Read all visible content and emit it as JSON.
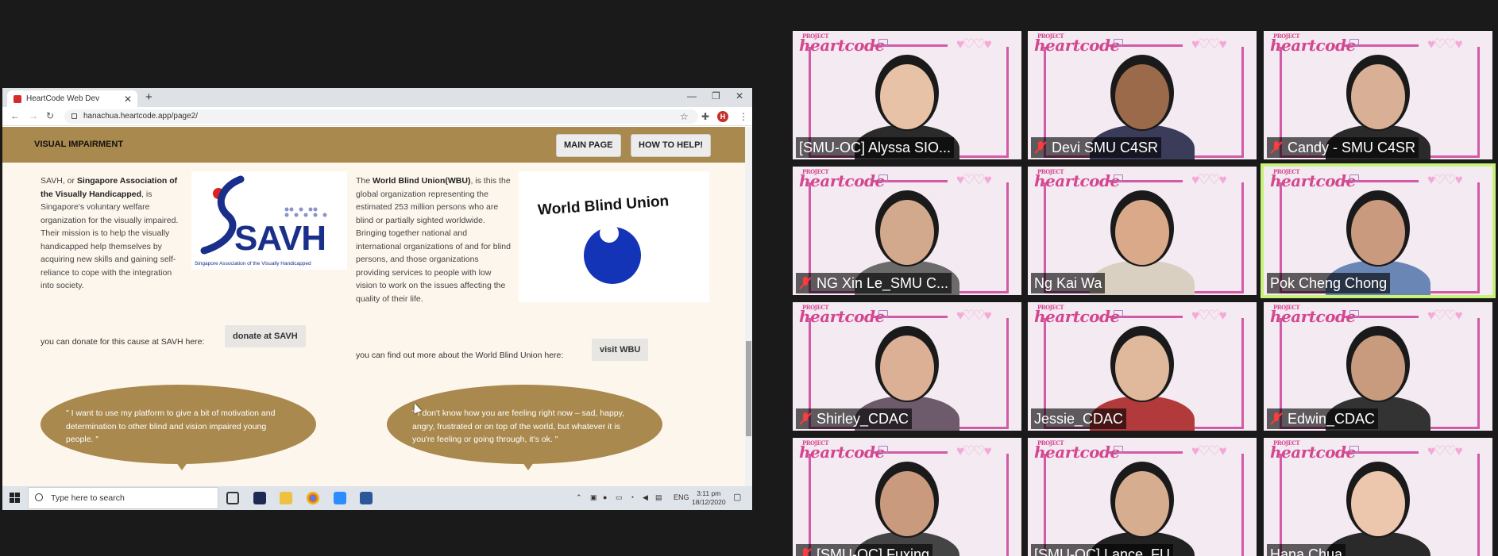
{
  "browser": {
    "tab_title": "HeartCode Web Dev",
    "new_tab": "+",
    "url": "hanachua.heartcode.app/page2/",
    "profile_initial": "H"
  },
  "site": {
    "nav_title": "VISUAL IMPAIRMENT",
    "main_page_button": "MAIN PAGE",
    "how_to_help_button": "HOW TO HELP!"
  },
  "savh": {
    "intro_prefix": "SAVH, or ",
    "name_bold": "Singapore Association of the Visually Handicapped",
    "description": ", is Singapore's voluntary welfare organization for the visually impaired. Their mission is to help the visually handicapped help themselves by acquiring new skills and gaining self-reliance to cope with the integration into society.",
    "logo_text": "SAVH",
    "logo_subtext": "Singapore Association of the Visually Handicapped",
    "cta_text": "you can donate for this cause at SAVH here:",
    "cta_button": "donate at SAVH"
  },
  "wbu": {
    "intro_prefix": "The ",
    "name_bold": "World Blind Union(WBU)",
    "description": ", is this the global organization representing the estimated 253 million persons who are blind or partially sighted worldwide. Bringing together national and international organizations of and for blind persons, and those organizations providing services to people with low vision to work on the issues affecting the quality of their life.",
    "logo_text": "World Blind Union",
    "cta_text": "you can find out more about the World Blind Union here:",
    "cta_button": "visit WBU"
  },
  "quotes": [
    "\" I want to use my platform to give a bit of motivation and determination to other blind and vision impaired young people. \"",
    "\" I don't know how you are feeling right now – sad, happy, angry, frustrated or on top of the world, but whatever it is you're feeling or going through, it's ok. \""
  ],
  "taskbar": {
    "search_placeholder": "Type here to search",
    "language": "ENG",
    "time": "3:11 pm",
    "date": "18/12/2020"
  },
  "participants": [
    {
      "name": "[SMU-OC] Alyssa SIO...",
      "muted": false
    },
    {
      "name": "Devi SMU C4SR",
      "muted": true
    },
    {
      "name": "Candy - SMU C4SR",
      "muted": true
    },
    {
      "name": "NG Xin Le_SMU C...",
      "muted": true
    },
    {
      "name": "Ng Kai Wa",
      "muted": false
    },
    {
      "name": "Pok Cheng Chong",
      "muted": false
    },
    {
      "name": "Shirley_CDAC",
      "muted": true
    },
    {
      "name": "Jessie_CDAC",
      "muted": false
    },
    {
      "name": "Edwin_CDAC",
      "muted": true
    },
    {
      "name": "[SMU-OC] Fuxing",
      "muted": true
    },
    {
      "name": "[SMU-OC] Lance_FU",
      "muted": false
    },
    {
      "name": "Hana Chua",
      "muted": false
    }
  ],
  "tile_logo": "heartcode",
  "tile_logo_small": "PROJECT",
  "colors": {
    "site_accent": "#a9894d",
    "page_bg": "#fdf6ec",
    "active_speaker": "#c8f27a",
    "mute_red": "#ff3b3b",
    "savh_navy": "#1a2f8a",
    "wbu_blue": "#1434b8"
  }
}
